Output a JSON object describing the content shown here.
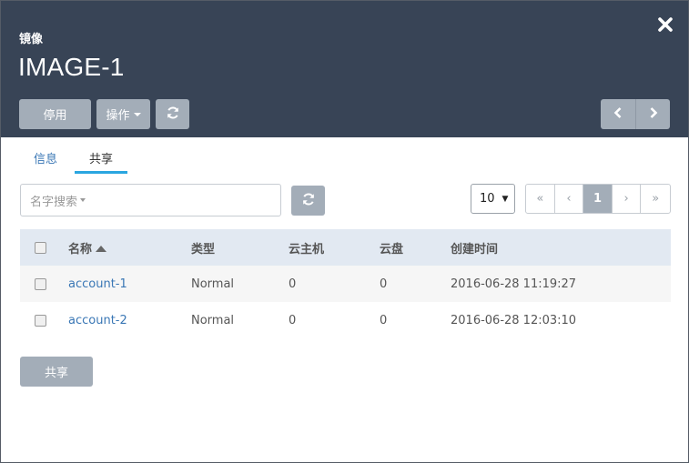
{
  "header": {
    "kicker": "镜像",
    "title": "IMAGE-1",
    "buttons": {
      "disable_label": "停用",
      "ops_label": "操作"
    },
    "icons": {
      "close": "close-icon",
      "refresh": "refresh-icon",
      "prev": "chevron-left-icon",
      "next": "chevron-right-icon"
    }
  },
  "tabs": [
    {
      "label": "信息",
      "active": false
    },
    {
      "label": "共享",
      "active": true
    }
  ],
  "search": {
    "placeholder": "名字搜索"
  },
  "pagination": {
    "page_size": "10",
    "first": "«",
    "prev": "‹",
    "current": "1",
    "next": "›",
    "last": "»"
  },
  "table": {
    "columns": [
      "名称",
      "类型",
      "云主机",
      "云盘",
      "创建时间"
    ],
    "rows": [
      {
        "name": "account-1",
        "type": "Normal",
        "vms": "0",
        "disks": "0",
        "created": "2016-06-28 11:19:27"
      },
      {
        "name": "account-2",
        "type": "Normal",
        "vms": "0",
        "disks": "0",
        "created": "2016-06-28 12:03:10"
      }
    ]
  },
  "footer": {
    "share_label": "共享"
  },
  "colors": {
    "header_bg": "#384456",
    "button_gray": "#a3adb8",
    "link": "#3a77b5",
    "tab_underline": "#2aa6e0",
    "table_head_bg": "#e2e9f2"
  }
}
